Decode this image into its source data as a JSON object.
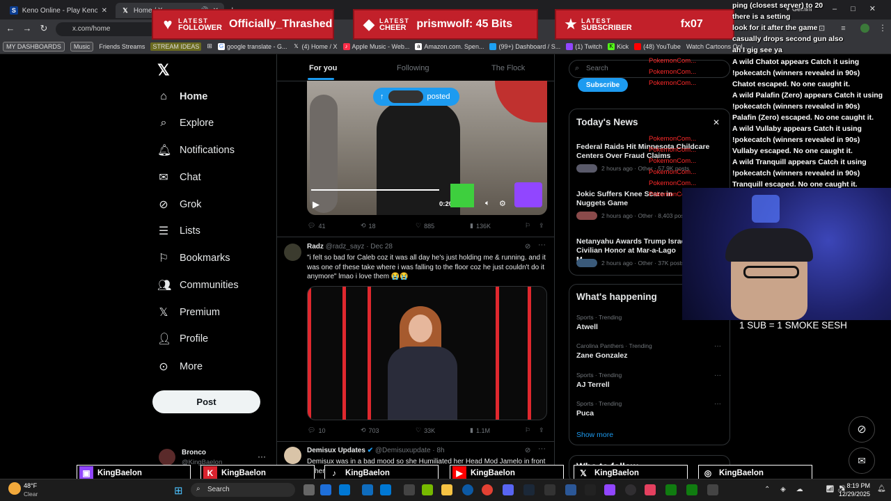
{
  "browser": {
    "tabs": [
      {
        "label": "Keno Online - Play Keno Game"
      },
      {
        "label": "Home / X"
      }
    ],
    "new_tab": "+",
    "gemini_label": "Gemini",
    "url": "x.com/home",
    "bookmarks": [
      "MY DASHBOARDS",
      "Music",
      "Friends Streams",
      "STREAM IDEAS",
      "google translate - G...",
      "(4) Home / X",
      "Apple Music - Web...",
      "Amazon.com. Spen...",
      "(99+) Dashboard / S...",
      "(1) Twitch",
      "Kick",
      "(48) YouTube",
      "Watch Cartoons Onl..."
    ]
  },
  "alerts": [
    {
      "l1": "LATEST",
      "l2": "FOLLOWER",
      "value": "Officially_Thrashed",
      "icon": "♥"
    },
    {
      "l1": "LATEST",
      "l2": "CHEER",
      "value": "prismwolf: 45 Bits",
      "icon": "◆"
    },
    {
      "l1": "LATEST",
      "l2": "SUBSCRIBER",
      "value": "fx07",
      "icon": "★"
    }
  ],
  "nav": {
    "items": [
      "Home",
      "Explore",
      "Notifications",
      "Chat",
      "Grok",
      "Lists",
      "Bookmarks",
      "Communities",
      "Premium",
      "Profile",
      "More"
    ],
    "post": "Post",
    "account_name": "Bronco",
    "account_handle": "@KingBaelon"
  },
  "feed": {
    "tabs": [
      "For you",
      "Following",
      "The Flock"
    ],
    "posted_pill": "posted",
    "video_time": "0:20 / 0:36",
    "post1_stats": {
      "replies": "41",
      "reposts": "18",
      "likes": "885",
      "views": "136K"
    },
    "post2": {
      "name": "Radz",
      "handle": "@radz_sayz · Dec 28",
      "text": "\"i felt so bad for Caleb coz it was all day he's just holding me & running. and it was one of these take where i was falling to the floor coz he just couldn't do it anymore\" lmao i love them 😭😭",
      "stats": {
        "replies": "10",
        "reposts": "703",
        "likes": "33K",
        "views": "1.1M"
      }
    },
    "post3": {
      "name": "Demisux Updates",
      "handle": "@Demisuxupdate · 8h",
      "text": "Demisux was in a bad mood so she Humiliated her Head Mod Jamelo in front of her friends at the Bowling arcade"
    }
  },
  "right": {
    "search_placeholder": "Search",
    "subscribe": "Subscribe",
    "news_title": "Today's News",
    "news": [
      {
        "title": "Federal Raids Hit Minnesota Childcare Centers Over Fraud Claims",
        "meta": "2 hours ago · Other · 57.9K posts"
      },
      {
        "title": "Jokic Suffers Knee Scare in Nuggets Game",
        "meta": "2 hours ago · Other · 8,403 posts"
      },
      {
        "title": "Netanyahu Awards Trump Israel Civilian Honor at Mar-a-Lago M...",
        "meta": "2 hours ago · Other · 37K posts"
      }
    ],
    "happening_title": "What's happening",
    "trends": [
      {
        "cat": "Sports · Trending",
        "name": "Atwell"
      },
      {
        "cat": "Carolina Panthers · Trending",
        "name": "Zane Gonzalez"
      },
      {
        "cat": "Sports · Trending",
        "name": "AJ Terrell"
      },
      {
        "cat": "Sports · Trending",
        "name": "Puca"
      }
    ],
    "show_more": "Show more",
    "who_to_follow": "Who to follow"
  },
  "chat": {
    "header_lines": [
      "ping (closest server) to 20",
      "there is a setting",
      "look for it after the game",
      "casually drops second gun also",
      "ah I gig see ya"
    ],
    "messages": [
      "A wild Chatot appears  Catch it using !pokecatch (winners revealed in 90s)",
      "Chatot escaped. No one caught it.",
      "A wild Palafin (Zero) appears  Catch it using !pokecatch (winners revealed in 90s)",
      "Palafin (Zero) escaped. No one caught it.",
      "A wild Vullaby appears  Catch it using !pokecatch (winners revealed in 90s)",
      "Vullaby escaped. No one caught it.",
      "A wild Tranquill appears  Catch it using !pokecatch (winners revealed in 90s)",
      "Tranquill escaped. No one caught it."
    ],
    "poke_label": "PokemonCom...",
    "webcam_caption": "1 SUB = 1 SMOKE SESH"
  },
  "socials": [
    {
      "platform": "twitch",
      "name": "KingBaelon",
      "color": "#9146ff"
    },
    {
      "platform": "kick",
      "name": "KingBaelon",
      "color": "#d9232e"
    },
    {
      "platform": "tiktok",
      "name": "KingBaelon",
      "color": "#000000"
    },
    {
      "platform": "youtube",
      "name": "KingBaelon",
      "color": "#ff0000"
    },
    {
      "platform": "x",
      "name": "KingBaelon",
      "color": "#000000"
    },
    {
      "platform": "instagram",
      "name": "KingBaelon",
      "color": "#c13584"
    }
  ],
  "taskbar": {
    "weather_temp": "48°F",
    "weather_desc": "Clear",
    "search_label": "Search",
    "time": "8:19 PM",
    "date": "12/29/2025"
  },
  "colors": {
    "accent_blue": "#1d9bf0",
    "alert_red": "#c2202a",
    "x_bg": "#000000"
  }
}
